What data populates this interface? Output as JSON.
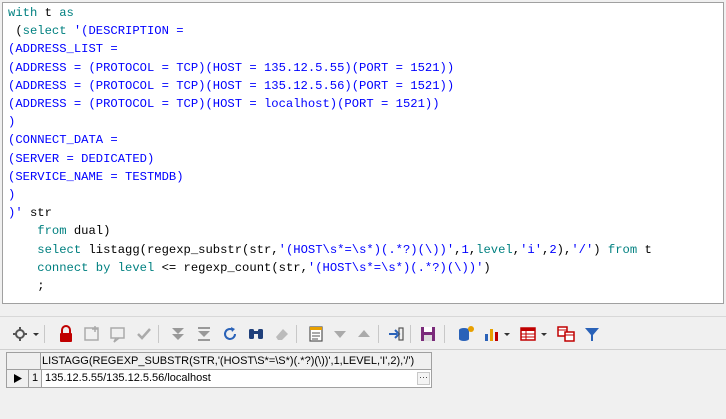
{
  "editor": {
    "lines": [
      [
        {
          "c": "kw",
          "t": "with"
        },
        {
          "c": "pl",
          "t": " t "
        },
        {
          "c": "kw",
          "t": "as"
        }
      ],
      [
        {
          "c": "pl",
          "t": " ("
        },
        {
          "c": "kw",
          "t": "select"
        },
        {
          "c": "str",
          "t": " '(DESCRIPTION ="
        }
      ],
      [
        {
          "c": "str",
          "t": "(ADDRESS_LIST ="
        }
      ],
      [
        {
          "c": "str",
          "t": "(ADDRESS = (PROTOCOL = TCP)(HOST = 135.12.5.55)(PORT = 1521))"
        }
      ],
      [
        {
          "c": "str",
          "t": "(ADDRESS = (PROTOCOL = TCP)(HOST = 135.12.5.56)(PORT = 1521))"
        }
      ],
      [
        {
          "c": "str",
          "t": "(ADDRESS = (PROTOCOL = TCP)(HOST = localhost)(PORT = 1521))"
        }
      ],
      [
        {
          "c": "str",
          "t": ")"
        }
      ],
      [
        {
          "c": "str",
          "t": "(CONNECT_DATA ="
        }
      ],
      [
        {
          "c": "str",
          "t": "(SERVER = DEDICATED)"
        }
      ],
      [
        {
          "c": "str",
          "t": "(SERVICE_NAME = TESTMDB)"
        }
      ],
      [
        {
          "c": "str",
          "t": ")"
        }
      ],
      [
        {
          "c": "str",
          "t": ")'"
        },
        {
          "c": "pl",
          "t": " str"
        }
      ],
      [
        {
          "c": "pl",
          "t": "    "
        },
        {
          "c": "kw",
          "t": "from"
        },
        {
          "c": "pl",
          "t": " dual)"
        }
      ],
      [
        {
          "c": "pl",
          "t": "    "
        },
        {
          "c": "kw",
          "t": "select"
        },
        {
          "c": "pl",
          "t": " listagg(regexp_substr(str,"
        },
        {
          "c": "str",
          "t": "'(HOST\\s*=\\s*)(.*?)(\\))'"
        },
        {
          "c": "pl",
          "t": ","
        },
        {
          "c": "str",
          "t": "1"
        },
        {
          "c": "pl",
          "t": ","
        },
        {
          "c": "kw",
          "t": "level"
        },
        {
          "c": "pl",
          "t": ","
        },
        {
          "c": "str",
          "t": "'i'"
        },
        {
          "c": "pl",
          "t": ","
        },
        {
          "c": "str",
          "t": "2"
        },
        {
          "c": "pl",
          "t": "),"
        },
        {
          "c": "str",
          "t": "'/'"
        },
        {
          "c": "pl",
          "t": ") "
        },
        {
          "c": "kw",
          "t": "from"
        },
        {
          "c": "pl",
          "t": " t"
        }
      ],
      [
        {
          "c": "pl",
          "t": "    "
        },
        {
          "c": "kw",
          "t": "connect by level"
        },
        {
          "c": "pl",
          "t": " <= regexp_count(str,"
        },
        {
          "c": "str",
          "t": "'(HOST\\s*=\\s*)(.*?)(\\))'"
        },
        {
          "c": "pl",
          "t": ")"
        }
      ],
      [
        {
          "c": "pl",
          "t": "    ;"
        }
      ]
    ]
  },
  "toolbar": {
    "icons": [
      "grid-options-icon",
      "lock-icon",
      "insert-record-icon",
      "delete-record-icon",
      "post-changes-icon",
      "clear-filter-icon",
      "query-by-example-icon",
      "refresh-icon",
      "find-icon",
      "eraser-icon",
      "single-record-view-icon",
      "next-page-icon",
      "previous-page-icon",
      "export-icon",
      "save-icon",
      "database-link-icon",
      "chart-icon",
      "table-view-icon",
      "compare-icon",
      "filter-icon"
    ]
  },
  "grid": {
    "column_header": "LISTAGG(REGEXP_SUBSTR(STR,'(HOST\\S*=\\S*)(.*?)(\\))',1,LEVEL,'I',2),'/')",
    "rows": [
      {
        "row_number": "1",
        "value": "135.12.5.55/135.12.5.56/localhost",
        "ellipsis": "···"
      }
    ]
  },
  "colors": {
    "keyword": "#008080",
    "string": "#0000ff",
    "plain": "#000000"
  }
}
